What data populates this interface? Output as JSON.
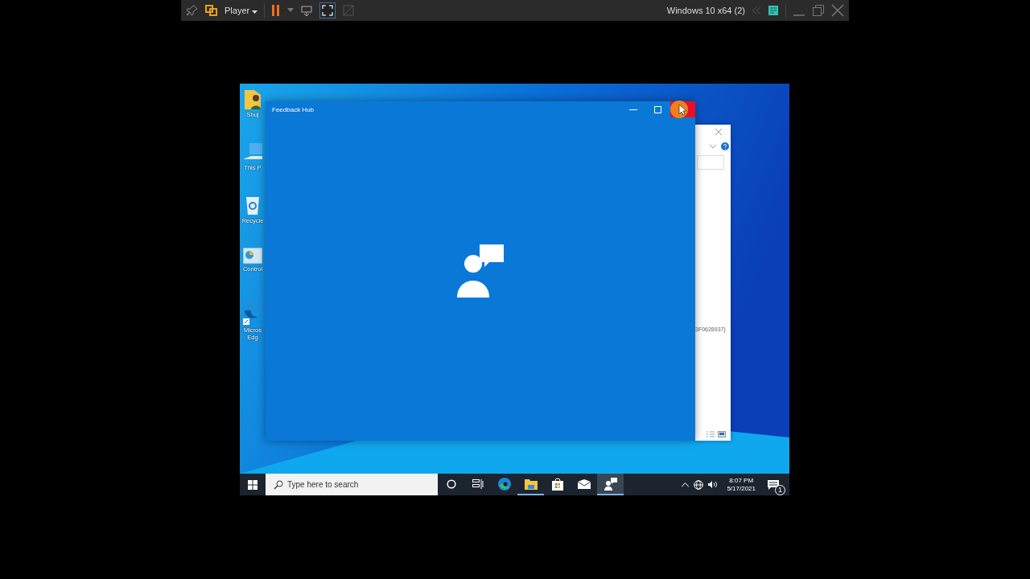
{
  "player_toolbar": {
    "menu": "Player",
    "paused": true,
    "vm_name": "Windows 10 x64 (2)"
  },
  "desktop_icons": [
    {
      "kind": "user-folder",
      "label": "Shuj"
    },
    {
      "kind": "computer",
      "label": "This P"
    },
    {
      "kind": "recycle-bin",
      "label": "Recycle"
    },
    {
      "kind": "control-panel",
      "label": "Control"
    },
    {
      "kind": "edge",
      "label": "Micros Edg"
    }
  ],
  "back_window": {
    "text": "3F0628937}"
  },
  "feedback_window": {
    "title": "Feedback Hub",
    "close_hovered": true
  },
  "taskbar": {
    "search": {
      "placeholder": "Type here to search"
    },
    "apps": [
      {
        "kind": "cortana",
        "running": false,
        "selected": false
      },
      {
        "kind": "task-view",
        "running": false,
        "selected": false
      },
      {
        "kind": "edge",
        "running": false,
        "selected": false
      },
      {
        "kind": "explorer",
        "running": true,
        "selected": false
      },
      {
        "kind": "store",
        "running": false,
        "selected": false
      },
      {
        "kind": "mail",
        "running": false,
        "selected": false
      },
      {
        "kind": "feedback",
        "running": true,
        "selected": true
      }
    ],
    "time": "8:07 PM",
    "date": "5/17/2021",
    "notifications": "1"
  }
}
